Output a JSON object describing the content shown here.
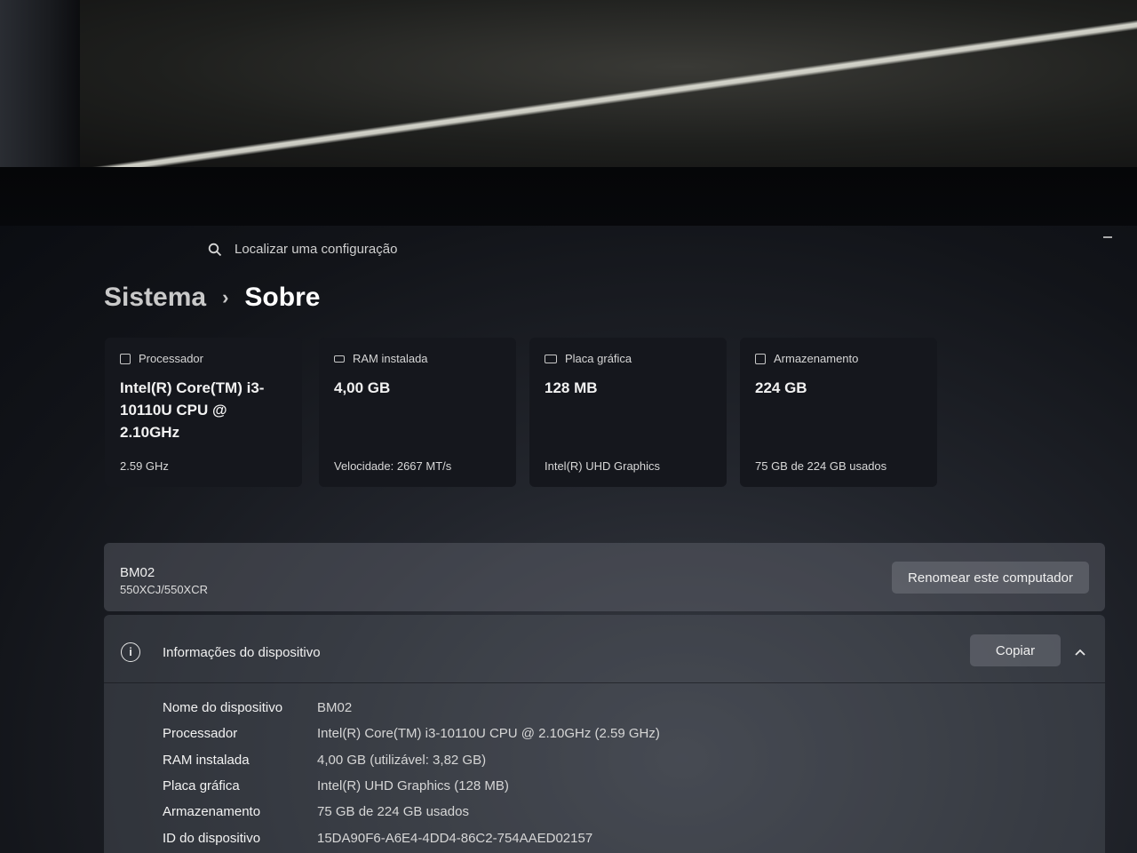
{
  "search": {
    "placeholder": "Localizar uma configuração"
  },
  "breadcrumb": {
    "parent": "Sistema",
    "separator": "›",
    "current": "Sobre"
  },
  "cards": [
    {
      "icon": "processor-icon",
      "label": "Processador",
      "value": "Intel(R) Core(TM) i3-10110U CPU @ 2.10GHz",
      "sub": "2.59 GHz"
    },
    {
      "icon": "ram-icon",
      "label": "RAM instalada",
      "value": "4,00 GB",
      "sub": "Velocidade: 2667 MT/s"
    },
    {
      "icon": "gpu-icon",
      "label": "Placa gráfica",
      "value": "128 MB",
      "sub": "Intel(R) UHD Graphics"
    },
    {
      "icon": "storage-icon",
      "label": "Armazenamento",
      "value": "224 GB",
      "sub": "75 GB de 224 GB usados"
    }
  ],
  "device": {
    "name": "BM02",
    "model": "550XCJ/550XCR",
    "rename_label": "Renomear este computador"
  },
  "info": {
    "title": "Informações do dispositivo",
    "copy_label": "Copiar",
    "rows": [
      {
        "key": "Nome do dispositivo",
        "value": "BM02"
      },
      {
        "key": "Processador",
        "value": "Intel(R) Core(TM) i3-10110U CPU @ 2.10GHz (2.59 GHz)"
      },
      {
        "key": "RAM instalada",
        "value": "4,00 GB (utilizável: 3,82 GB)"
      },
      {
        "key": "Placa gráfica",
        "value": "Intel(R) UHD Graphics (128 MB)"
      },
      {
        "key": "Armazenamento",
        "value": "75 GB de 224 GB usados"
      },
      {
        "key": "ID do dispositivo",
        "value": "15DA90F6-A6E4-4DD4-86C2-754AAED02157"
      }
    ]
  }
}
